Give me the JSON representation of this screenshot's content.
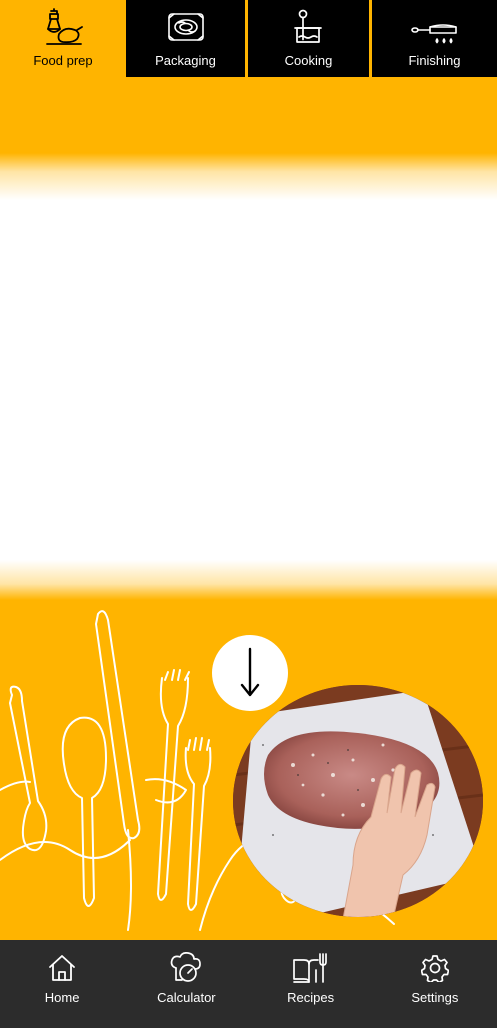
{
  "tabs": [
    {
      "label": "Food prep",
      "icon": "food-prep-icon",
      "active": true
    },
    {
      "label": "Packaging",
      "icon": "packaging-icon",
      "active": false
    },
    {
      "label": "Cooking",
      "icon": "cooking-icon",
      "active": false
    },
    {
      "label": "Finishing",
      "icon": "finishing-icon",
      "active": false
    }
  ],
  "hero": {
    "scroll_icon": "arrow-down-icon",
    "image": "seasoned-steak-photo",
    "background_icon": "cutlery-line-art"
  },
  "bottom_nav": [
    {
      "label": "Home",
      "icon": "home-icon"
    },
    {
      "label": "Calculator",
      "icon": "calculator-icon"
    },
    {
      "label": "Recipes",
      "icon": "recipes-icon"
    },
    {
      "label": "Settings",
      "icon": "settings-icon"
    }
  ],
  "colors": {
    "accent": "#ffb400",
    "tab_bar": "#000000",
    "nav_bar": "#2c2c2c"
  }
}
